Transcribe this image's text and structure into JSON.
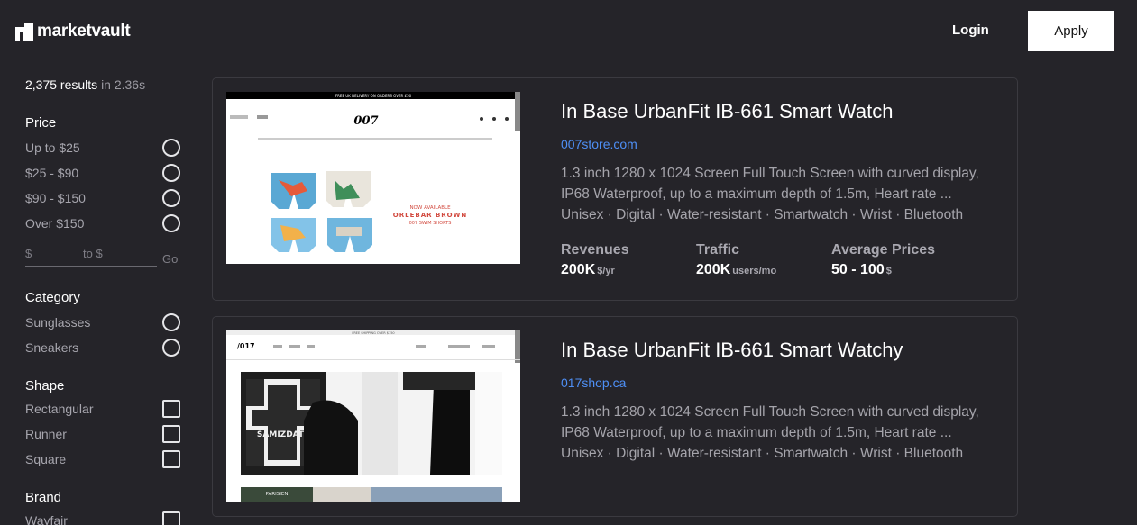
{
  "header": {
    "brand": "marketvault",
    "login_label": "Login",
    "apply_label": "Apply"
  },
  "sidebar": {
    "results_count": "2,375 results",
    "results_time": "in 2.36s",
    "price": {
      "title": "Price",
      "options": [
        "Up to $25",
        "$25 - $90",
        "$90 - $150",
        "Over $150"
      ],
      "min_placeholder": "$",
      "to_label": "to $",
      "go_label": "Go"
    },
    "category": {
      "title": "Category",
      "options": [
        "Sunglasses",
        "Sneakers"
      ]
    },
    "shape": {
      "title": "Shape",
      "options": [
        "Rectangular",
        "Runner",
        "Square"
      ]
    },
    "brand": {
      "title": "Brand",
      "options": [
        "Wayfair"
      ]
    }
  },
  "results": [
    {
      "title": "In Base UrbanFit IB-661 Smart Watch",
      "link": "007store.com",
      "desc": "1.3 inch 1280 x 1024 Screen Full Touch Screen with curved display, IP68 Waterproof, up to a maximum depth of 1.5m, Heart rate ...",
      "tags": "Unisex · Digital · Water-resistant · Smartwatch · Wrist · Bluetooth",
      "stats": [
        {
          "label": "Revenues",
          "value": "200K",
          "unit": "$/yr"
        },
        {
          "label": "Traffic",
          "value": "200K",
          "unit": "users/mo"
        },
        {
          "label": "Average Prices",
          "value": "50 - 100",
          "unit": "$"
        }
      ],
      "thumb": {
        "banner": "FREE UK DELIVERY ON ORDERS OVER £50",
        "logo": "007",
        "promo_1": "NOW AVAILABLE",
        "promo_2": "ORLEBAR BROWN",
        "promo_3": "007 SWIM SHORTS"
      }
    },
    {
      "title": "In Base UrbanFit IB-661 Smart Watchy",
      "link": "017shop.ca",
      "desc": "1.3 inch 1280 x 1024 Screen Full Touch Screen with curved display, IP68 Waterproof, up to a maximum depth of 1.5m, Heart rate ...",
      "tags": "Unisex · Digital · Water-resistant · Smartwatch · Wrist · Bluetooth",
      "thumb": {
        "banner": "FREE SHIPPING OVER $150",
        "logo": "/017",
        "sign_1": "SAMIZDAT",
        "sign_2": "PARISIEN"
      }
    }
  ]
}
